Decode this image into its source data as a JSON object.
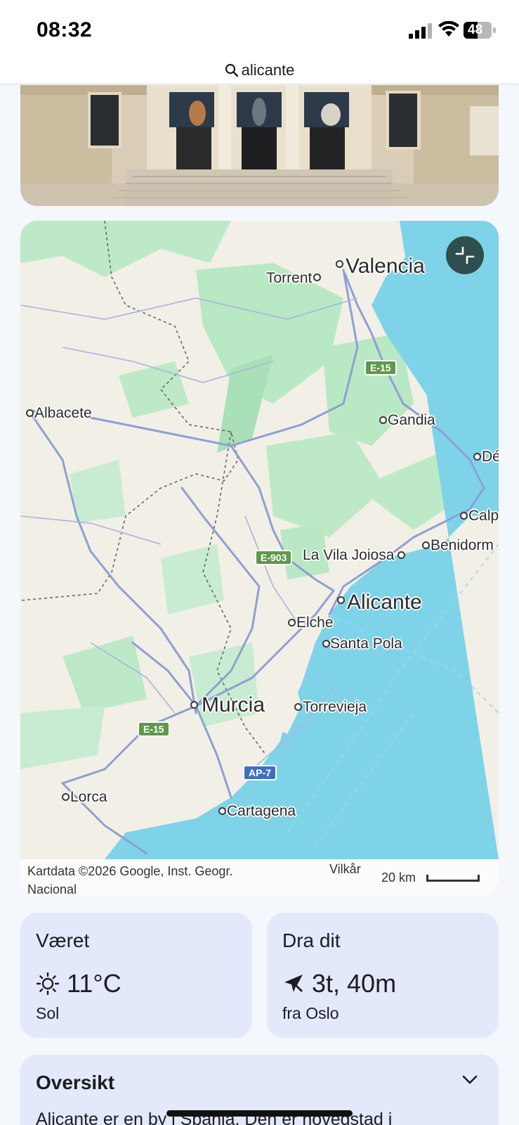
{
  "status_bar": {
    "time": "08:32",
    "battery": "48"
  },
  "search": {
    "query": "alicante"
  },
  "map": {
    "cities": {
      "valencia": "Valencia",
      "torrent": "Torrent",
      "albacete": "Albacete",
      "gandia": "Gandia",
      "denia": "Dé",
      "calpe": "Calp",
      "benidorm": "Benidorm",
      "la_vila_joiosa": "La Vila Joiosa",
      "alicante": "Alicante",
      "elche": "Elche",
      "santa_pola": "Santa Pola",
      "murcia": "Murcia",
      "torrevieja": "Torrevieja",
      "lorca": "Lorca",
      "cartagena": "Cartagena"
    },
    "roads": {
      "e15_north": "E-15",
      "e903": "E-903",
      "e15_south": "E-15",
      "ap7": "AP-7"
    },
    "attribution": "Kartdata ©2026 Google, Inst. Geogr. Nacional",
    "terms": "Vilkår",
    "scale": "20 km"
  },
  "weather": {
    "title": "Været",
    "temperature": "11°C",
    "condition": "Sol",
    "icon": "sun-icon"
  },
  "travel": {
    "title": "Dra dit",
    "duration": "3t, 40m",
    "origin": "fra Oslo",
    "icon": "airplane-icon"
  },
  "overview": {
    "title": "Oversikt",
    "text": "Alicante er en by i Spania. Den er hovedstad i"
  },
  "colors": {
    "card_bg": "#e3e9fb",
    "sea": "#7fd3e8",
    "map_land": "#f2efe6",
    "map_green": "#b9e8c4",
    "road": "#8f9fd4"
  }
}
